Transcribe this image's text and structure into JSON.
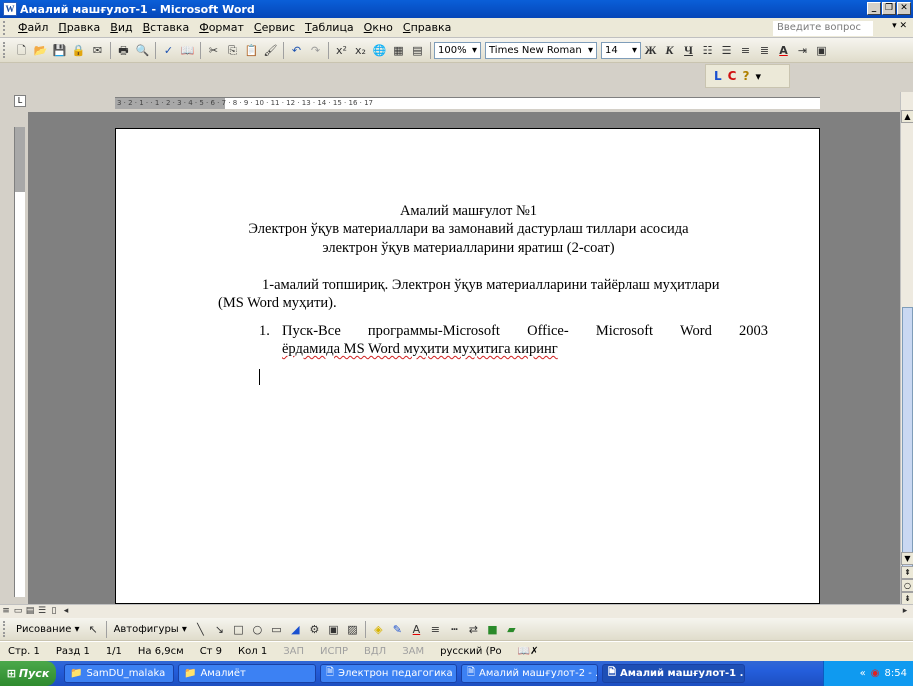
{
  "window": {
    "title": "Амалий машғулот-1 - Microsoft Word"
  },
  "menu": {
    "items": [
      "Файл",
      "Правка",
      "Вид",
      "Вставка",
      "Формат",
      "Сервис",
      "Таблица",
      "Окно",
      "Справка"
    ],
    "ask_placeholder": "Введите вопрос"
  },
  "toolbar": {
    "zoom": "100%",
    "font": "Times New Roman",
    "size": "14",
    "bold": "Ж",
    "italic": "К",
    "underline": "Ч"
  },
  "toolbar2": {
    "l": "L",
    "c": "C",
    "help": "?"
  },
  "ruler": {
    "marks": "3 · 2 · 1 · · 1 · 2 · 3 · 4 · 5 · 6 · 7 · 8 · 9 · 10 · 11 · 12 · 13 · 14 · 15 · 16 · 17"
  },
  "document": {
    "title": "Амалий машғулот №1",
    "subtitle1": "Электрон ўқув материаллари ва замонавий дастурлаш тиллари асосида",
    "subtitle2": "электрон ўқув материалларини яратиш (2-соат)",
    "task_line1": "1-амалий топшириқ. Электрон ўқув материалларини тайёрлаш муҳитлари",
    "task_line2": "(MS Word муҳити).",
    "item_num": "1.",
    "item_line1": "Пуск-Все программы-Microsoft Office- Microsoft Word 2003",
    "item_line2": "ёрдамида MS Word муҳити муҳитига киринг"
  },
  "drawbar": {
    "draw": "Рисование ▾",
    "autoshapes": "Автофигуры ▾"
  },
  "status": {
    "page": "Стр. 1",
    "section": "Разд 1",
    "pages": "1/1",
    "at": "На 6,9см",
    "line": "Ст 9",
    "col": "Кол 1",
    "rec": "ЗАП",
    "trk": "ИСПР",
    "ext": "ВДЛ",
    "ovr": "ЗАМ",
    "lang": "русский (Ро"
  },
  "taskbar": {
    "start": "Пуск",
    "tasks": [
      "SamDU_malaka",
      "Амалиёт",
      "Электрон педагогика ...",
      "Амалий машғулот-2 - ...",
      "Амалий машғулот-1 ..."
    ],
    "time": "8:54"
  }
}
